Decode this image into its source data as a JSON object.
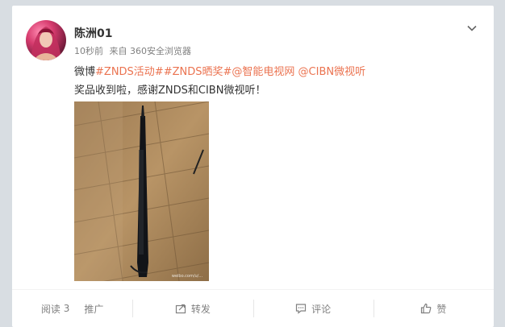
{
  "post": {
    "user": "陈洲01",
    "time": "10秒前",
    "source": "来自 360安全浏览器",
    "text_prefix": "微博",
    "tags": [
      "#ZNDS活动#",
      "#ZNDS晒奖#",
      "@智能电视网",
      "@CIBN微视听"
    ],
    "body": "奖品收到啦，感谢ZNDS和CIBN微视听！",
    "photo_watermark": "weibo.com/u/..."
  },
  "actions": {
    "read_label": "阅读",
    "read_count": "3",
    "promote_label": "推广",
    "forward_label": "转发",
    "comment_label": "评论",
    "like_label": "赞"
  },
  "icons": {
    "menu": "chevron-down-icon",
    "forward": "forward-icon",
    "comment": "comment-icon",
    "like": "thumbs-up-icon"
  },
  "colors": {
    "link": "#eb7350",
    "text": "#333333",
    "muted": "#808080"
  }
}
